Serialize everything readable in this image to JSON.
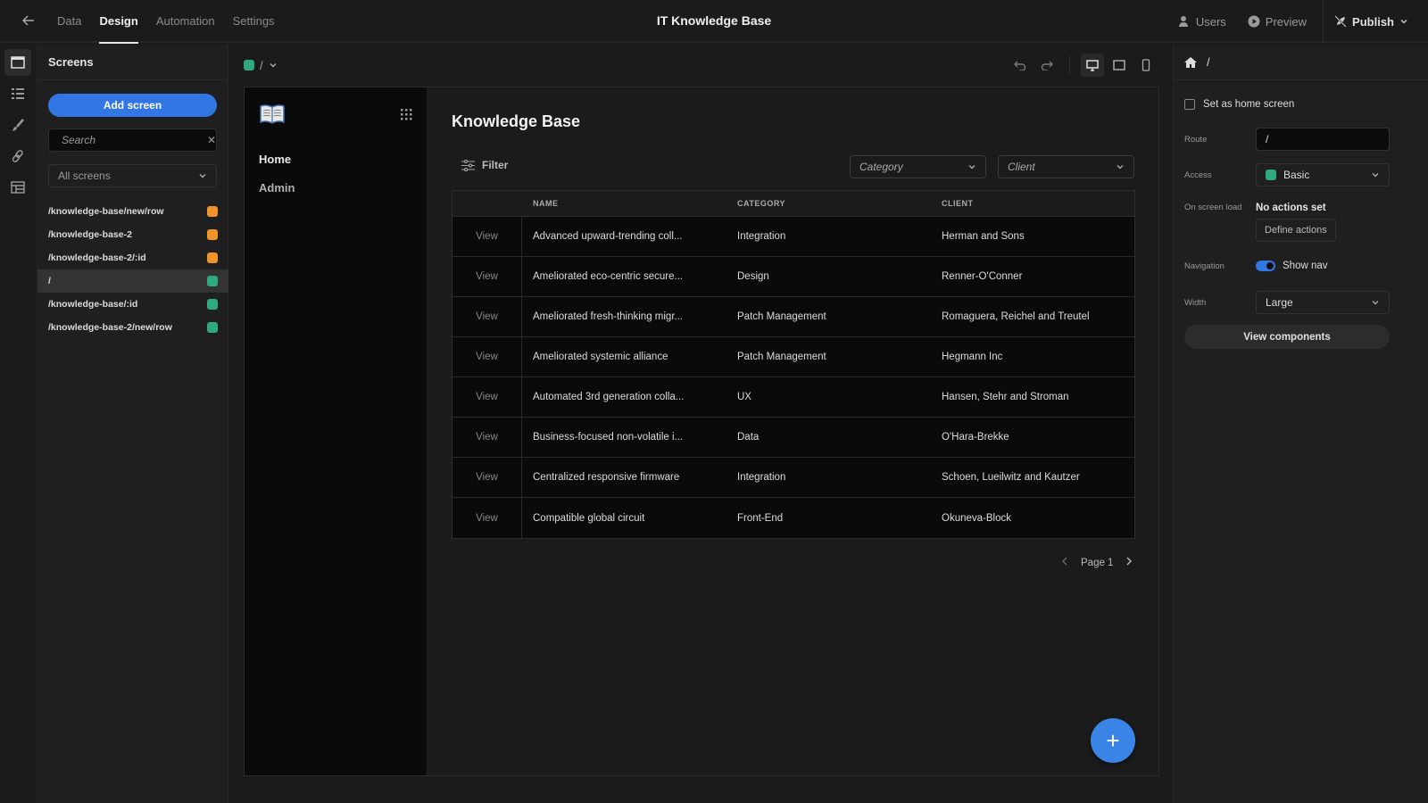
{
  "app": {
    "title": "IT Knowledge Base",
    "tabs": [
      {
        "label": "Data",
        "active": false
      },
      {
        "label": "Design",
        "active": true
      },
      {
        "label": "Automation",
        "active": false
      },
      {
        "label": "Settings",
        "active": false
      }
    ],
    "actions": {
      "users": "Users",
      "preview": "Preview",
      "publish": "Publish"
    }
  },
  "screens_panel": {
    "title": "Screens",
    "add_button": "Add screen",
    "search_placeholder": "Search",
    "filter_value": "All screens",
    "items": [
      {
        "route": "/knowledge-base/new/row",
        "color": "#f0932a",
        "selected": false
      },
      {
        "route": "/knowledge-base-2",
        "color": "#f0932a",
        "selected": false
      },
      {
        "route": "/knowledge-base-2/:id",
        "color": "#f0932a",
        "selected": false
      },
      {
        "route": "/",
        "color": "#2ea981",
        "selected": true
      },
      {
        "route": "/knowledge-base/:id",
        "color": "#2ea981",
        "selected": false
      },
      {
        "route": "/knowledge-base-2/new/row",
        "color": "#2ea981",
        "selected": false
      }
    ]
  },
  "canvas": {
    "breadcrumb": "/",
    "breadcrumb_color": "#2ea981",
    "app_nav": {
      "links": [
        "Home",
        "Admin"
      ]
    },
    "page_title": "Knowledge Base",
    "filter_label": "Filter",
    "category_placeholder": "Category",
    "client_placeholder": "Client",
    "table": {
      "columns": [
        "",
        "NAME",
        "CATEGORY",
        "CLIENT"
      ],
      "view_label": "View",
      "rows": [
        {
          "name": "Advanced upward-trending coll...",
          "category": "Integration",
          "client": "Herman and Sons"
        },
        {
          "name": "Ameliorated eco-centric secure...",
          "category": "Design",
          "client": "Renner-O'Conner"
        },
        {
          "name": "Ameliorated fresh-thinking migr...",
          "category": "Patch Management",
          "client": "Romaguera, Reichel and Treutel"
        },
        {
          "name": "Ameliorated systemic alliance",
          "category": "Patch Management",
          "client": "Hegmann Inc"
        },
        {
          "name": "Automated 3rd generation colla...",
          "category": "UX",
          "client": "Hansen, Stehr and Stroman"
        },
        {
          "name": "Business-focused non-volatile i...",
          "category": "Data",
          "client": "O'Hara-Brekke"
        },
        {
          "name": "Centralized responsive firmware",
          "category": "Integration",
          "client": "Schoen, Lueilwitz and Kautzer"
        },
        {
          "name": "Compatible global circuit",
          "category": "Front-End",
          "client": "Okuneva-Block"
        }
      ]
    },
    "pagination": {
      "label": "Page 1"
    },
    "fab_label": "+"
  },
  "properties": {
    "route_header": "/",
    "home_screen_label": "Set as home screen",
    "home_screen_checked": false,
    "route_label": "Route",
    "route_value": "/",
    "access_label": "Access",
    "access_value": "Basic",
    "access_color": "#2ea981",
    "on_load_label": "On screen load",
    "on_load_value": "No actions set",
    "define_actions": "Define actions",
    "navigation_label": "Navigation",
    "show_nav_label": "Show nav",
    "show_nav_on": true,
    "width_label": "Width",
    "width_value": "Large",
    "view_components": "View components"
  },
  "colors": {
    "accent": "#3276e4",
    "fab": "#3a84e6"
  }
}
